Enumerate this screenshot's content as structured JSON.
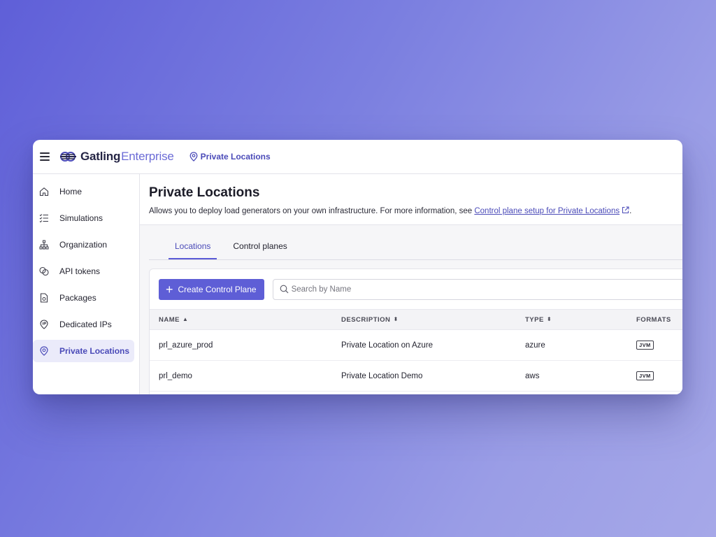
{
  "brand": {
    "name_bold": "Gatling",
    "name_light": "Enterprise"
  },
  "breadcrumb": {
    "label": "Private Locations"
  },
  "sidebar": {
    "items": [
      {
        "label": "Home",
        "icon": "home-icon"
      },
      {
        "label": "Simulations",
        "icon": "checklist-icon"
      },
      {
        "label": "Organization",
        "icon": "org-tree-icon"
      },
      {
        "label": "API tokens",
        "icon": "tokens-icon"
      },
      {
        "label": "Packages",
        "icon": "package-icon"
      },
      {
        "label": "Dedicated IPs",
        "icon": "ip-pin-icon"
      },
      {
        "label": "Private Locations",
        "icon": "location-pin-icon",
        "active": true
      }
    ]
  },
  "page": {
    "title": "Private Locations",
    "description": "Allows you to deploy load generators on your own infrastructure. For more information, see ",
    "link_text": "Control plane setup for Private Locations",
    "description_end": "."
  },
  "tabs": [
    {
      "label": "Locations",
      "active": true
    },
    {
      "label": "Control planes",
      "active": false
    }
  ],
  "toolbar": {
    "create_label": "Create Control Plane",
    "search_placeholder": "Search by Name"
  },
  "table": {
    "columns": [
      "NAME",
      "DESCRIPTION",
      "TYPE",
      "FORMATS"
    ],
    "rows": [
      {
        "name": "prl_azure_prod",
        "description": "Private Location on Azure",
        "type": "azure",
        "format": "JVM"
      },
      {
        "name": "prl_demo",
        "description": "Private Location Demo",
        "type": "aws",
        "format": "JVM"
      }
    ]
  },
  "colors": {
    "accent": "#5e5ed6",
    "accent_text": "#4a4ab8",
    "active_bg": "#ebebfa"
  }
}
